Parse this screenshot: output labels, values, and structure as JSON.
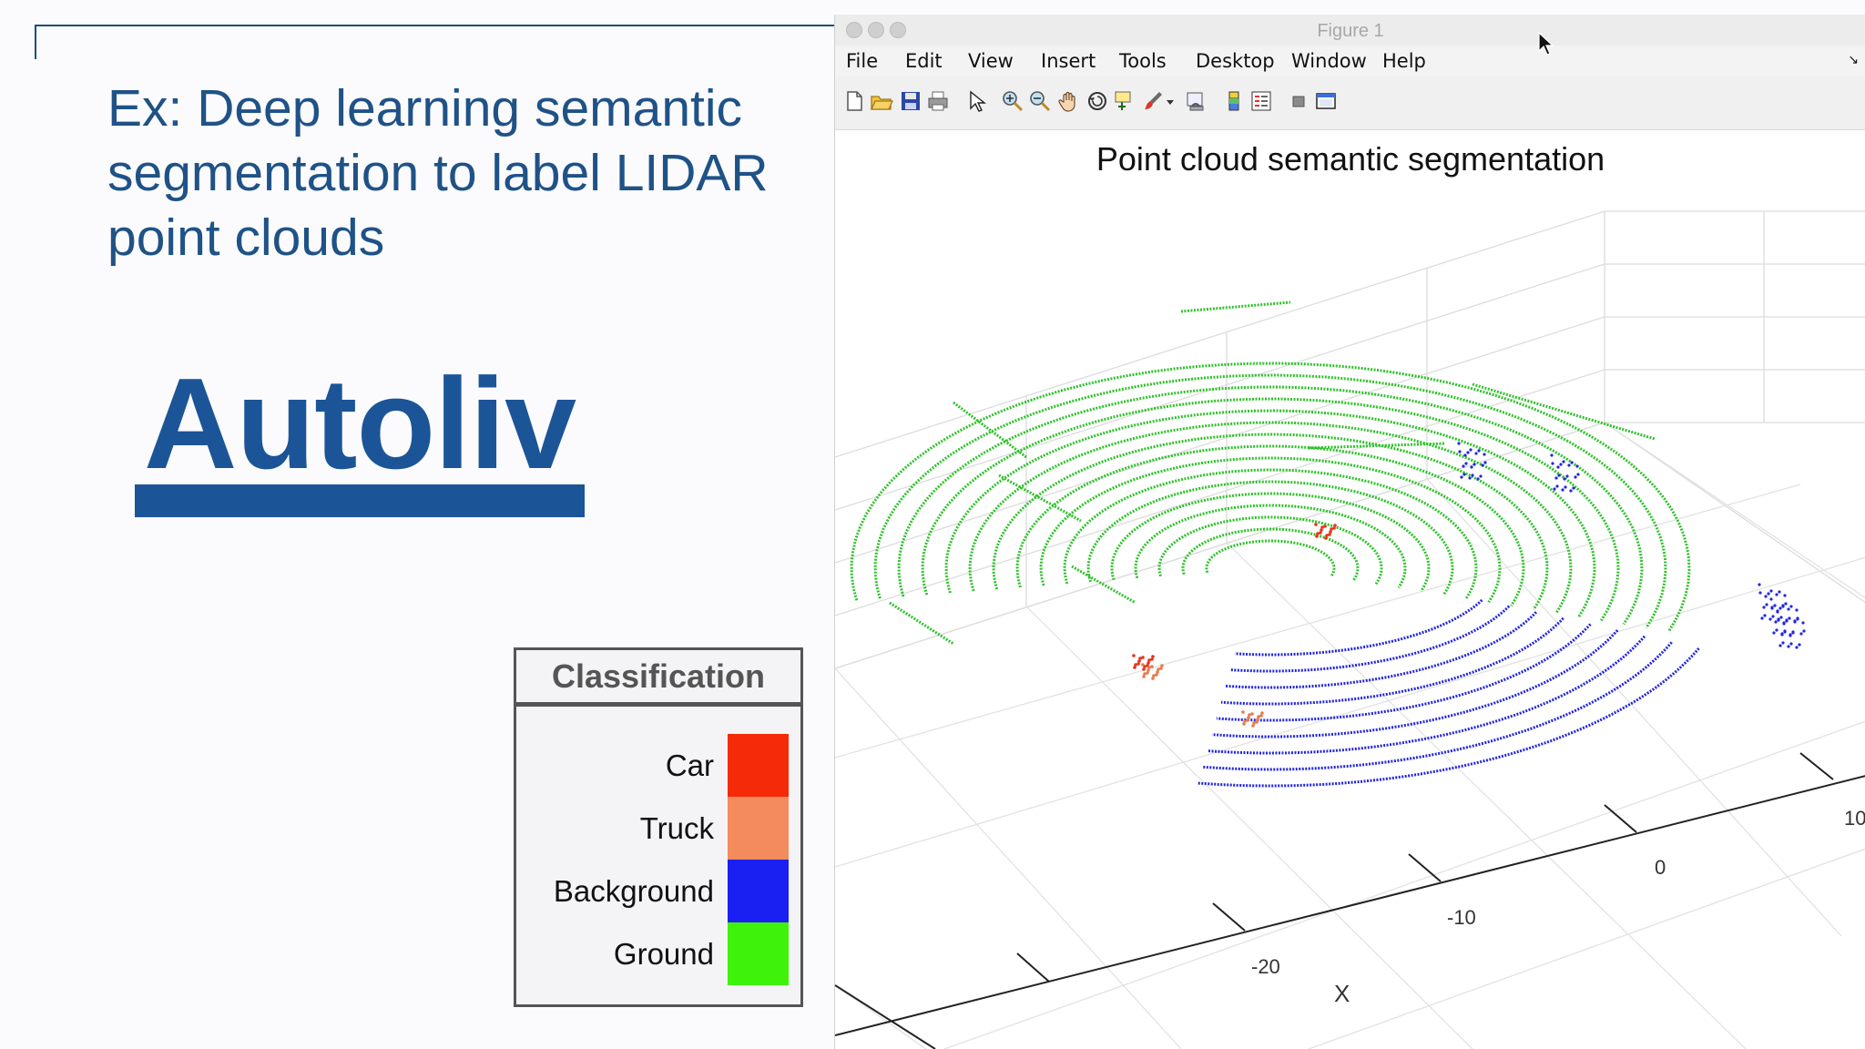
{
  "slide": {
    "title": "Ex: Deep learning semantic segmentation to label LIDAR point clouds",
    "logo_text": "Autoliv"
  },
  "legend": {
    "title": "Classification",
    "items": [
      {
        "label": "Car",
        "color": "#f42a08"
      },
      {
        "label": "Truck",
        "color": "#f48b5c"
      },
      {
        "label": "Background",
        "color": "#1a20f2"
      },
      {
        "label": "Ground",
        "color": "#3ef20a"
      }
    ]
  },
  "window": {
    "title": "Figure 1",
    "menu": [
      "File",
      "Edit",
      "View",
      "Insert",
      "Tools",
      "Desktop",
      "Window",
      "Help"
    ],
    "toolbar_icons": [
      "new-figure-icon",
      "open-file-icon",
      "save-icon",
      "print-icon",
      "pointer-icon",
      "zoom-in-icon",
      "zoom-out-icon",
      "pan-hand-icon",
      "rotate-3d-icon",
      "data-cursor-icon",
      "brush-icon",
      "dropdown-arrow-icon",
      "link-plot-icon",
      "colorbar-icon",
      "legend-icon",
      "hide-plot-tools-icon",
      "show-plot-tools-icon"
    ]
  },
  "plot": {
    "title": "Point cloud semantic segmentation",
    "xlabel": "X",
    "x_ticks": [
      "10",
      "0",
      "-10",
      "-20"
    ],
    "colors": {
      "ground": "#2ec22a",
      "background": "#2226e0",
      "car": "#e8321a",
      "truck": "#e87a4a",
      "grid": "#dedede"
    }
  }
}
